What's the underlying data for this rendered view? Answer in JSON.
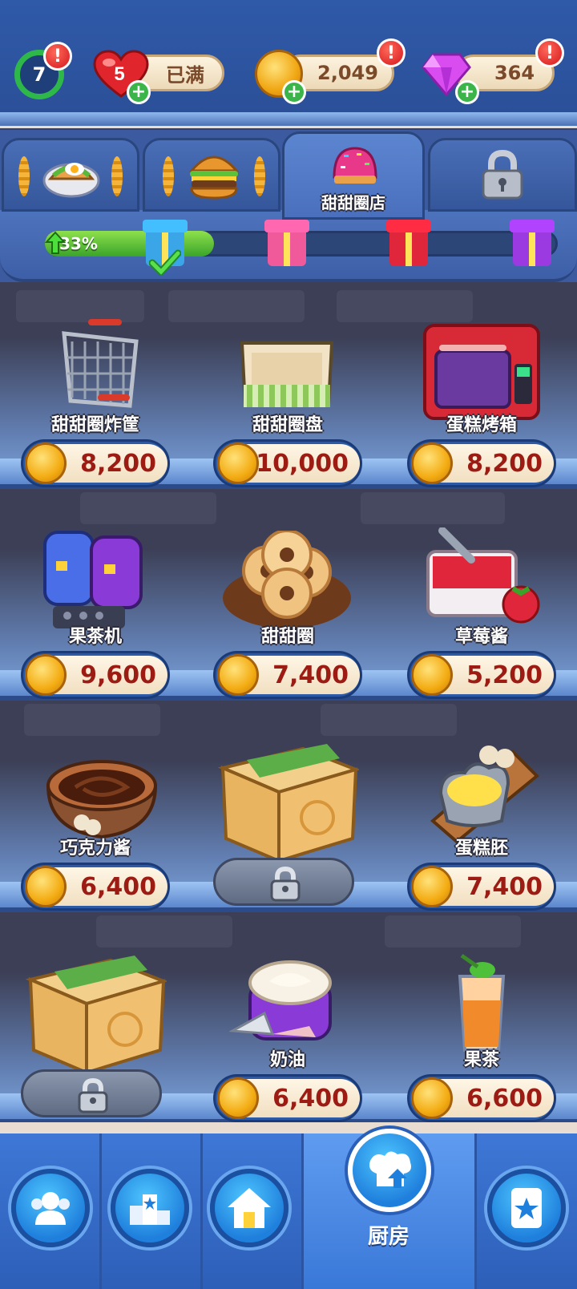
{
  "header": {
    "level": "7",
    "lives": "5",
    "lives_status": "已满",
    "coins": "2,049",
    "gems": "364",
    "alert_mark": "!",
    "plus_mark": "+"
  },
  "tabs": [
    {
      "icon": "sandwich-icon",
      "label": ""
    },
    {
      "icon": "burger-icon",
      "label": ""
    },
    {
      "icon": "donut-icon",
      "label": "甜甜圈店"
    },
    {
      "icon": "lock-icon",
      "label": ""
    }
  ],
  "progress": {
    "percent": 33,
    "label": "33%"
  },
  "shop_items": [
    {
      "name": "甜甜圈炸筐",
      "price": "8,200",
      "locked": false
    },
    {
      "name": "甜甜圈盘",
      "price": "10,000",
      "locked": false
    },
    {
      "name": "蛋糕烤箱",
      "price": "8,200",
      "locked": false
    },
    {
      "name": "果茶机",
      "price": "9,600",
      "locked": false
    },
    {
      "name": "甜甜圈",
      "price": "7,400",
      "locked": false
    },
    {
      "name": "草莓酱",
      "price": "5,200",
      "locked": false
    },
    {
      "name": "巧克力酱",
      "price": "6,400",
      "locked": false
    },
    {
      "name": "",
      "price": "",
      "locked": true
    },
    {
      "name": "蛋糕胚",
      "price": "7,400",
      "locked": false
    },
    {
      "name": "",
      "price": "",
      "locked": true
    },
    {
      "name": "奶油",
      "price": "6,400",
      "locked": false
    },
    {
      "name": "果茶",
      "price": "6,600",
      "locked": false
    }
  ],
  "nav": {
    "items": [
      {
        "icon": "friends-icon"
      },
      {
        "icon": "leaderboard-icon"
      },
      {
        "icon": "home-icon"
      },
      {
        "icon": "kitchen-chef-hat-icon",
        "label": "厨房",
        "selected": true
      },
      {
        "icon": "card-collection-icon"
      }
    ]
  }
}
